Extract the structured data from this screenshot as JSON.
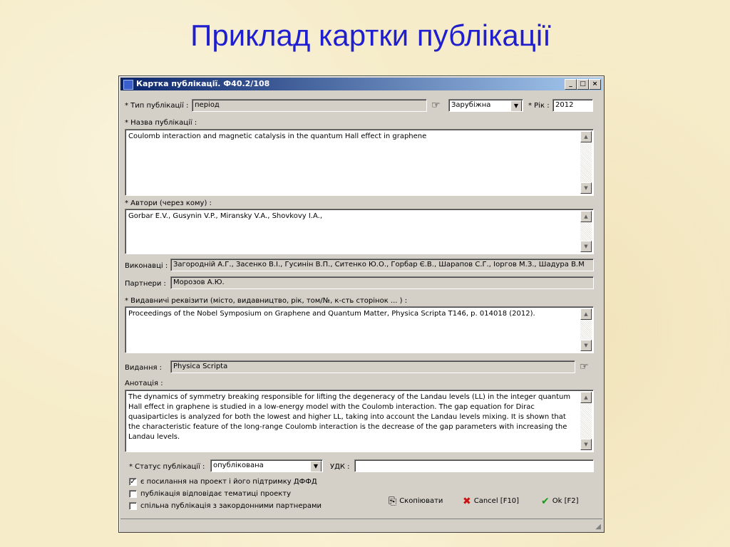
{
  "slide": {
    "title": "Приклад картки публікації"
  },
  "window": {
    "title": "Картка публікації. Ф40.2/108",
    "controls": {
      "minimize": "_",
      "maximize": "□",
      "close": "×"
    }
  },
  "form": {
    "pub_type_label": "* Тип публікації :",
    "pub_type_value": "період",
    "origin_value": "Зарубіжна",
    "year_label": "* Рік :",
    "year_value": "2012",
    "title_label": "* Назва публікації :",
    "title_value": "Coulomb interaction and magnetic catalysis in the quantum Hall effect in graphene",
    "authors_label": "* Автори (через кому) :",
    "authors_value": "Gorbar E.V., Gusynin V.P., Miransky V.A., Shovkovy I.A.,",
    "executors_label": "Виконавці :",
    "executors_value": "Загородній А.Г., Засенко В.І., Гусинін В.П., Ситенко Ю.О., Горбар Є.В., Шарапов С.Г., Іоргов М.З., Шадура В.М",
    "partners_label": "Партнери :",
    "partners_value": "Морозов А.Ю.",
    "publisher_label": "* Видавничі реквізити (місто, видавництво, рік, том/№, к-сть сторінок ... ) :",
    "publisher_value": "Proceedings of the Nobel Symposium on Graphene and Quantum Matter, Physica Scripta T146, p. 014018 (2012).",
    "edition_label": "Видання :",
    "edition_value": "Physica Scripta",
    "abstract_label": "Анотація :",
    "abstract_value": "The dynamics of symmetry breaking responsible for lifting the degeneracy of the Landau levels (LL) in the integer quantum Hall effect in graphene is studied in a low-energy model with the Coulomb interaction. The gap equation for Dirac quasiparticles is analyzed for both the lowest and higher LL, taking into account the Landau levels mixing. It is shown that the characteristic feature of the long-range Coulomb interaction is the decrease of the gap parameters with increasing the Landau levels.",
    "status_label": "* Статус публікації :",
    "status_value": "опублікована",
    "udk_label": "УДК :",
    "udk_value": ""
  },
  "checkboxes": [
    {
      "label": "є посилання на проект і його підтримку ДФФД",
      "checked": true
    },
    {
      "label": "публікація відповідає тематиці проекту",
      "checked": false
    },
    {
      "label": "спільна публікація з закордонними партнерами",
      "checked": false
    }
  ],
  "buttons": {
    "copy": "Скопіювати",
    "cancel": "Cancel [F10]",
    "ok": "Ok [F2]"
  },
  "icons": {
    "pointer": "pointing-hand-icon",
    "dropdown": "▼",
    "scroll_up": "▲",
    "scroll_down": "▼",
    "check": "✓"
  },
  "colors": {
    "title_blue": "#1f1fd0",
    "titlebar_start": "#0a246a",
    "titlebar_end": "#a6caf0",
    "window_gray": "#d4d0c8",
    "cancel_red": "#cc1111",
    "ok_green": "#1a9a1a"
  }
}
